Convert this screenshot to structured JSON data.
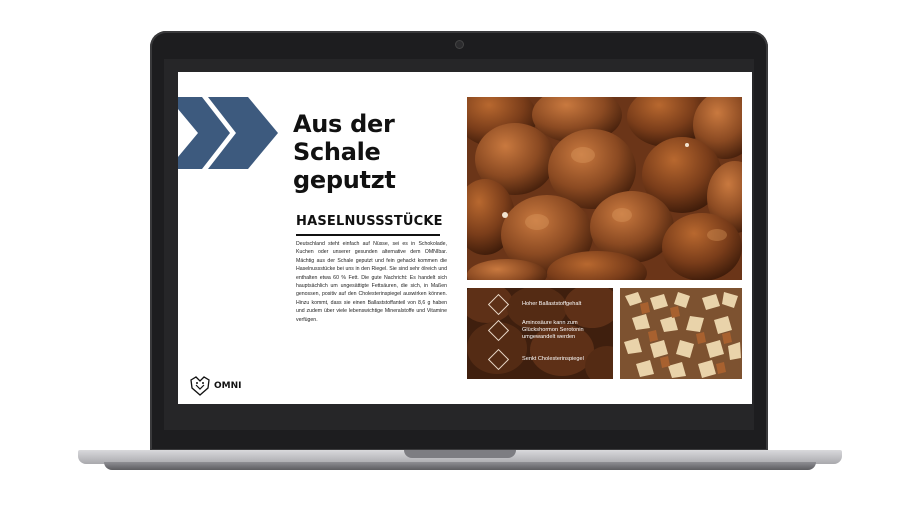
{
  "slide": {
    "headline_lines": [
      "Aus der",
      "Schale",
      "geputzt"
    ],
    "subheading": "HASELNUSSSTÜCKE",
    "body": "Deutschland steht einfach auf Nüsse, sei es in Schokolade, Kuchen oder unserer gesunden alternative dem OMNIbar. Mächtig aus der Schale geputzt und fein gehackt kommen die Haselnussstücke bei uns in den Riegel. Sie sind sehr ölreich und enthalten etwa 60 % Fett. Die gute Nachricht: Es handelt sich hauptsächlich um ungesättigte Fettsäuren, die sich, in Maßen genossen, positiv auf den Cholesterinspiegel auswirken können. Hinzu kommt, dass sie einen Ballaststoffanteil von 8,6 g haben und zudem über viele lebenswichtige Mineralstoffe und Vitamine verfügen.",
    "benefits": [
      "Hoher Ballaststoffgehalt",
      "Aminosäure kann zum Glückshormon Serotonin umgewandelt werden",
      "Senkt Cholesterinspiegel"
    ],
    "logo_text": "OMNI",
    "colors": {
      "chevron": "#3d5a7e",
      "hazelnut": "#8b4a22",
      "text": "#111111"
    }
  }
}
